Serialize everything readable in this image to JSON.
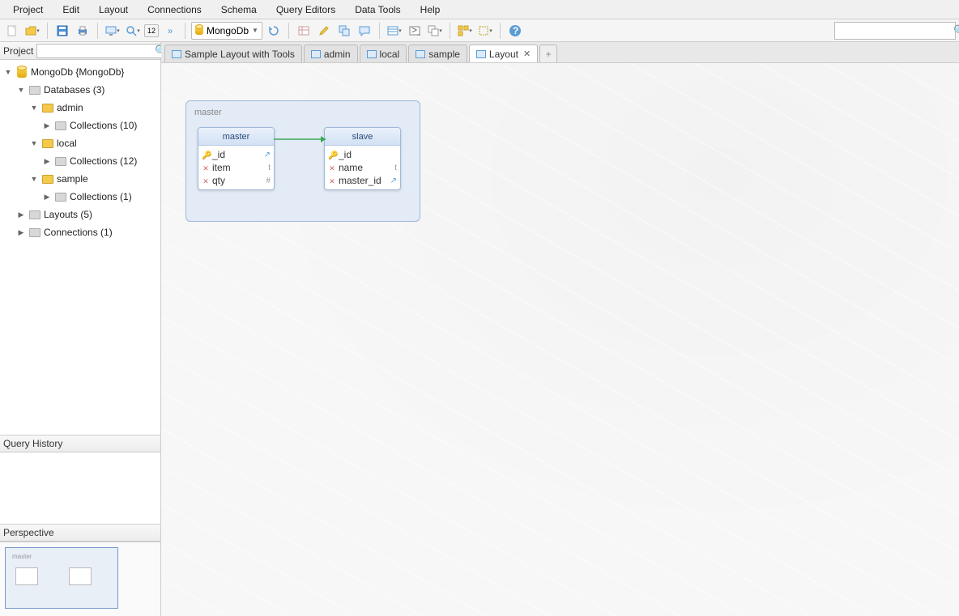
{
  "menu": [
    "Project",
    "Edit",
    "Layout",
    "Connections",
    "Schema",
    "Query Editors",
    "Data Tools",
    "Help"
  ],
  "toolbar": {
    "connection_label": "MongoDb",
    "badge": "12"
  },
  "sidebar": {
    "project_label": "Project",
    "query_history_label": "Query History",
    "perspective_label": "Perspective",
    "mm_label": "master",
    "tree": {
      "root": "MongoDb {MongoDb}",
      "databases_label": "Databases (3)",
      "dbs": [
        {
          "name": "admin",
          "coll": "Collections (10)"
        },
        {
          "name": "local",
          "coll": "Collections (12)"
        },
        {
          "name": "sample",
          "coll": "Collections (1)"
        }
      ],
      "layouts": "Layouts (5)",
      "connections": "Connections (1)"
    }
  },
  "tabs": [
    {
      "label": "Sample Layout with Tools",
      "active": false
    },
    {
      "label": "admin",
      "active": false
    },
    {
      "label": "local",
      "active": false
    },
    {
      "label": "sample",
      "active": false
    },
    {
      "label": "Layout",
      "active": true,
      "closable": true
    }
  ],
  "diagram": {
    "group_title": "master",
    "entities": [
      {
        "name": "master",
        "fields": [
          {
            "icon": "key",
            "name": "_id",
            "type": "↗"
          },
          {
            "icon": "x",
            "name": "item",
            "type": "t"
          },
          {
            "icon": "x",
            "name": "qty",
            "type": "#"
          }
        ]
      },
      {
        "name": "slave",
        "fields": [
          {
            "icon": "key",
            "name": "_id",
            "type": ""
          },
          {
            "icon": "x",
            "name": "name",
            "type": "t"
          },
          {
            "icon": "x",
            "name": "master_id",
            "type": "↗"
          }
        ]
      }
    ]
  }
}
